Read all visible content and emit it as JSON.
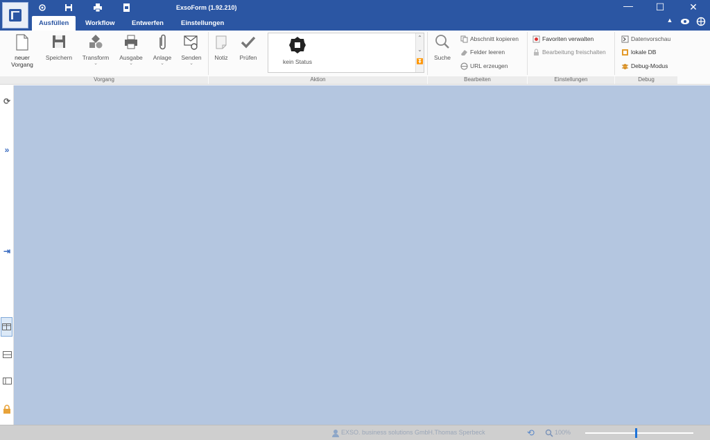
{
  "window": {
    "title": "ExsoForm (1.92.210)",
    "controls": [
      "minimize-icon",
      "maximize-icon",
      "close-icon"
    ]
  },
  "quick_access": [
    "settings-icon",
    "save-icon",
    "print-icon",
    "export-icon"
  ],
  "tabs": [
    {
      "label": "Ausfüllen",
      "active": true
    },
    {
      "label": "Workflow",
      "active": false
    },
    {
      "label": "Entwerfen",
      "active": false
    },
    {
      "label": "Einstellungen",
      "active": false
    }
  ],
  "ribbon": {
    "vorgang": {
      "label": "Vorgang",
      "buttons": {
        "neuer_vorgang": "neuer\nVorgang",
        "speichern": "Speichern",
        "transform": "Transform",
        "ausgabe": "Ausgabe",
        "anlage": "Anlage",
        "senden": "Senden"
      }
    },
    "notiz": "Notiz",
    "pruefen": "Prüfen",
    "aktion": {
      "label": "Aktion",
      "status": "kein Status"
    },
    "bearbeiten": {
      "label": "Bearbeiten",
      "suche": "Suche",
      "abschnitt_kopieren": "Abschnitt kopieren",
      "felder_leeren": "Felder leeren",
      "url_erzeugen": "URL erzeugen"
    },
    "einstellungen": {
      "label": "Einstellungen",
      "favoriten": "Favoriten verwalten",
      "bearbeitung": "Bearbeitung freischalten"
    },
    "debug": {
      "label": "Debug",
      "datenvorschau": "Datenvorschau",
      "lokale_db": "lokale DB",
      "debug_modus": "Debug-Modus"
    }
  },
  "statusbar": {
    "user": "EXSO. business solutions GmbH.Thomas Sperbeck",
    "zoom": "100%",
    "zoom_level": 0.46
  },
  "colors": {
    "titlebar": "#2b56a3",
    "workspace": "#b4c6e0",
    "accent": "#1e73d8"
  }
}
